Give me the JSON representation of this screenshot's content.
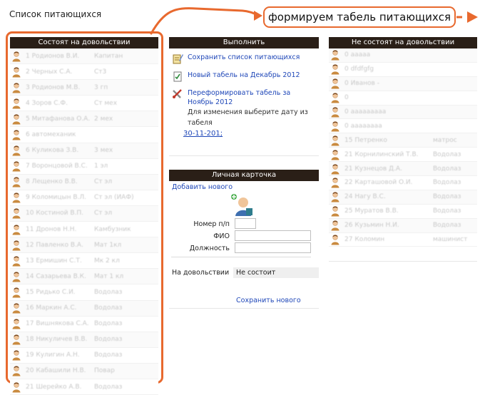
{
  "page": {
    "title": "Список питающихся"
  },
  "callout": {
    "text": "формируем табель питающихся",
    "accent": "#e8692e"
  },
  "left_panel": {
    "title": "Состоят на довольствии",
    "rows": [
      {
        "name": "1   Родионов В.И.",
        "pos": "Капитан"
      },
      {
        "name": "2   Черных С.А.",
        "pos": "Ст3"
      },
      {
        "name": "3   Родионов М.В.",
        "pos": "3 гп"
      },
      {
        "name": "4   Зоров С.Ф.",
        "pos": "Ст мех"
      },
      {
        "name": "5   Митафанова О.А.",
        "pos": "2 мех"
      },
      {
        "name": "6   автомеханик",
        "pos": ""
      },
      {
        "name": "6   Куликова З.В.",
        "pos": "3 мех"
      },
      {
        "name": "7   Воронцовой В.С.",
        "pos": "1 эл"
      },
      {
        "name": "8   Лещенко В.В.",
        "pos": "Ст эл"
      },
      {
        "name": "9   Коломицын В.Л.",
        "pos": "Ст эл (ИАФ)"
      },
      {
        "name": "10  Костиной В.П.",
        "pos": "Ст эл"
      },
      {
        "name": "11  Дронов Н.Н.",
        "pos": "Камбузник"
      },
      {
        "name": "12  Павленко В.А.",
        "pos": "Мат 1кл"
      },
      {
        "name": "13  Ермишин С.Т.",
        "pos": "Мк 2 кл"
      },
      {
        "name": "14  Сазарьева В.К.",
        "pos": "Мат 1 кл"
      },
      {
        "name": "15  Ридько С.И.",
        "pos": "Водолаз"
      },
      {
        "name": "16  Маркин А.С.",
        "pos": "Водолаз"
      },
      {
        "name": "17  Вишнякова С.А.",
        "pos": "Водолаз"
      },
      {
        "name": "18  Никуличев В.В.",
        "pos": "Водолаз"
      },
      {
        "name": "19  Кулигин А.Н.",
        "pos": "Водолаз"
      },
      {
        "name": "20  Кабашили Н.В.",
        "pos": "Повар"
      },
      {
        "name": "21  Шерейко А.В.",
        "pos": "Водолаз"
      }
    ]
  },
  "exec_panel": {
    "title": "Выполнить",
    "save_list": "Сохранить список питающихся",
    "new_tabel": "Новый табель на Декабрь 2012",
    "reform_line1": "Переформировать табель за",
    "reform_line2": "Ноябрь 2012",
    "note_line1": "Для изменения выберите дату из",
    "note_line2": "табеля",
    "date": "30-11-201;"
  },
  "card_panel": {
    "title": "Личная карточка",
    "add_new": "Добавить нового",
    "label_num": "Номер п/п",
    "label_fio": "ФИО",
    "label_pos": "Должность",
    "status_label": "На довольствии",
    "status_value": "Не состоит",
    "save_new": "Сохранить нового"
  },
  "right_panel": {
    "title": "Не состоят на довольствии",
    "rows": [
      {
        "name": "0   ааааа",
        "pos": ""
      },
      {
        "name": "0   dfdfgfg",
        "pos": ""
      },
      {
        "name": "0   Иванов -",
        "pos": ""
      },
      {
        "name": "0",
        "pos": ""
      },
      {
        "name": "0   ааааааааа",
        "pos": ""
      },
      {
        "name": "0   аааааааа",
        "pos": ""
      },
      {
        "name": "15  Петренко",
        "pos": "матрос"
      },
      {
        "name": "21  Корнилинский Т.В.",
        "pos": "Водолаз"
      },
      {
        "name": "21  Кузнецов Д.А.",
        "pos": "Водолаз"
      },
      {
        "name": "22  Карташовой О.И.",
        "pos": "Водолаз"
      },
      {
        "name": "24  Нагу В.С.",
        "pos": "Водолаз"
      },
      {
        "name": "25  Муратов В.В.",
        "pos": "Водолаз"
      },
      {
        "name": "26  Кузьмин Н.И.",
        "pos": "Водолаз"
      },
      {
        "name": "27  Коломин",
        "pos": "машинист"
      }
    ]
  }
}
